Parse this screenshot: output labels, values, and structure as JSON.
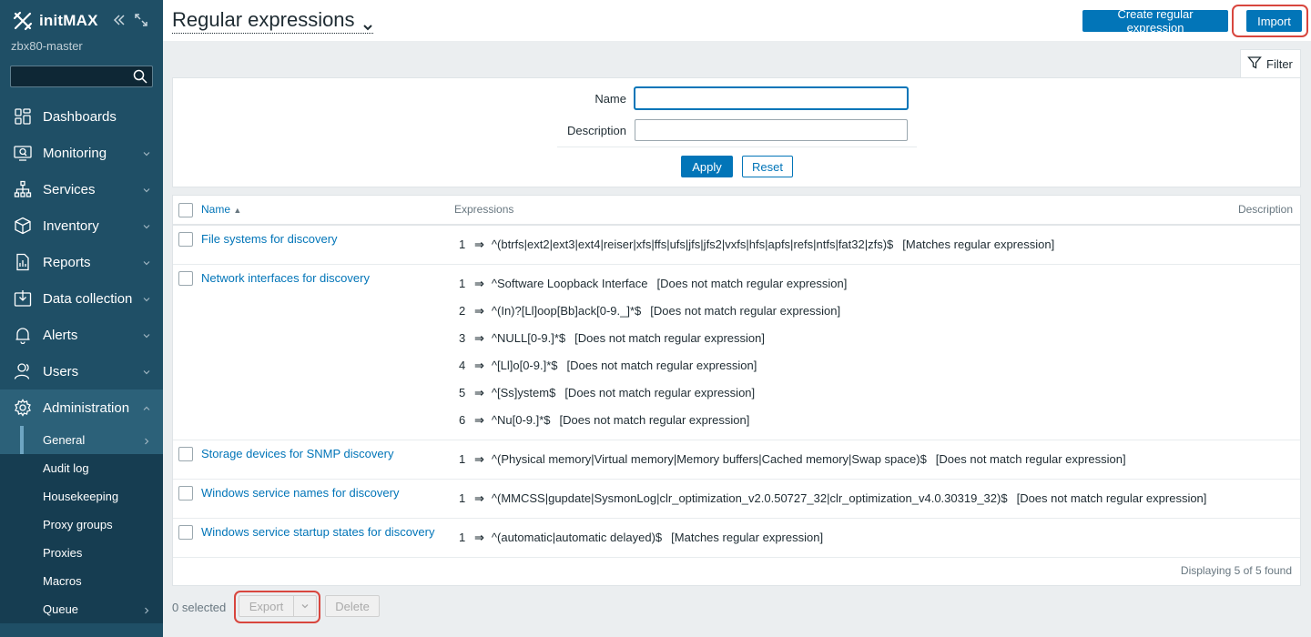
{
  "sidebar": {
    "brand": "initMAX",
    "server": "zbx80-master",
    "search_value": "",
    "menu": [
      {
        "label": "Dashboards",
        "icon": "dashboards-icon"
      },
      {
        "label": "Monitoring",
        "icon": "monitoring-icon"
      },
      {
        "label": "Services",
        "icon": "services-icon"
      },
      {
        "label": "Inventory",
        "icon": "inventory-icon"
      },
      {
        "label": "Reports",
        "icon": "reports-icon"
      },
      {
        "label": "Data collection",
        "icon": "data-collection-icon"
      },
      {
        "label": "Alerts",
        "icon": "alerts-icon"
      },
      {
        "label": "Users",
        "icon": "users-icon"
      },
      {
        "label": "Administration",
        "icon": "administration-icon"
      }
    ],
    "submenu": [
      {
        "label": "General"
      },
      {
        "label": "Audit log"
      },
      {
        "label": "Housekeeping"
      },
      {
        "label": "Proxy groups"
      },
      {
        "label": "Proxies"
      },
      {
        "label": "Macros"
      },
      {
        "label": "Queue"
      }
    ]
  },
  "header": {
    "title": "Regular expressions",
    "create_label": "Create regular expression",
    "import_label": "Import"
  },
  "filter": {
    "tab_label": "Filter",
    "name_label": "Name",
    "name_value": "",
    "description_label": "Description",
    "description_value": "",
    "apply_label": "Apply",
    "reset_label": "Reset"
  },
  "table": {
    "columns": {
      "name": "Name",
      "sort_indicator": "▲",
      "expressions": "Expressions",
      "description": "Description"
    },
    "arrow": "⇒",
    "rows": [
      {
        "name": "File systems for discovery",
        "expressions": [
          {
            "n": "1",
            "expr": "^(btrfs|ext2|ext3|ext4|reiser|xfs|ffs|ufs|jfs|jfs2|vxfs|hfs|apfs|refs|ntfs|fat32|zfs)$",
            "result": "[Matches regular expression]"
          }
        ]
      },
      {
        "name": "Network interfaces for discovery",
        "expressions": [
          {
            "n": "1",
            "expr": "^Software Loopback Interface",
            "result": "[Does not match regular expression]"
          },
          {
            "n": "2",
            "expr": "^(In)?[Ll]oop[Bb]ack[0-9._]*$",
            "result": "[Does not match regular expression]"
          },
          {
            "n": "3",
            "expr": "^NULL[0-9.]*$",
            "result": "[Does not match regular expression]"
          },
          {
            "n": "4",
            "expr": "^[Ll]o[0-9.]*$",
            "result": "[Does not match regular expression]"
          },
          {
            "n": "5",
            "expr": "^[Ss]ystem$",
            "result": "[Does not match regular expression]"
          },
          {
            "n": "6",
            "expr": "^Nu[0-9.]*$",
            "result": "[Does not match regular expression]"
          }
        ]
      },
      {
        "name": "Storage devices for SNMP discovery",
        "expressions": [
          {
            "n": "1",
            "expr": "^(Physical memory|Virtual memory|Memory buffers|Cached memory|Swap space)$",
            "result": "[Does not match regular expression]"
          }
        ]
      },
      {
        "name": "Windows service names for discovery",
        "expressions": [
          {
            "n": "1",
            "expr": "^(MMCSS|gupdate|SysmonLog|clr_optimization_v2.0.50727_32|clr_optimization_v4.0.30319_32)$",
            "result": "[Does not match regular expression]"
          }
        ]
      },
      {
        "name": "Windows service startup states for discovery",
        "expressions": [
          {
            "n": "1",
            "expr": "^(automatic|automatic delayed)$",
            "result": "[Matches regular expression]"
          }
        ]
      }
    ],
    "footer": "Displaying 5 of 5 found"
  },
  "bottom": {
    "selected": "0 selected",
    "export_label": "Export",
    "delete_label": "Delete"
  }
}
